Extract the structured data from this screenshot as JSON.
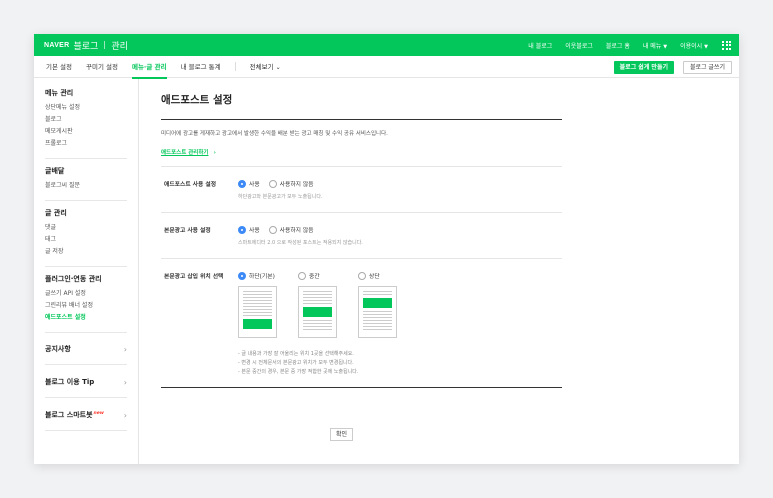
{
  "topbar": {
    "logo": "NAVER",
    "blog": "블로그",
    "manage": "관리",
    "nav": [
      "내 블로그",
      "이웃블로그",
      "블로그 홈",
      "내 메뉴",
      "이용이시"
    ]
  },
  "tabs": {
    "items": [
      "기본 설정",
      "꾸미기 설정",
      "메뉴·글 관리",
      "내 블로그 통계"
    ],
    "active_index": 2,
    "view_all": "전체보기",
    "primary_button": "블로그 쉽게 만들기",
    "secondary_button": "블로그 글쓰기"
  },
  "sidebar": {
    "sections": [
      {
        "title": "메뉴 관리",
        "items": [
          "상단메뉴 설정",
          "블로그",
          "메모게시판",
          "프롤로그"
        ]
      },
      {
        "title": "글배달",
        "items": [
          "블로그씨 질문"
        ]
      },
      {
        "title": "글 관리",
        "items": [
          "댓글",
          "태그",
          "글 저장"
        ]
      },
      {
        "title": "플러그인·연동 관리",
        "items": [
          "글쓰기 API 설정",
          "그린리뷰 배너 설정",
          "애드포스트 설정"
        ],
        "active": "애드포스트 설정"
      }
    ],
    "collapsed": [
      "공지사항",
      "블로그 이용 Tip",
      "블로그 스마트봇"
    ],
    "new_badge": "new"
  },
  "main": {
    "title": "애드포스트 설정",
    "description": "미디어에 광고를 게재하고 광고에서 발생한 수익을 배분 받는 광고 매칭 및 수익 공유 서비스입니다.",
    "link": "애드포스트 관리하기",
    "link_suffix": "›",
    "rows": [
      {
        "label": "애드포스트 사용 설정",
        "options": [
          "사용",
          "사용하지 않음"
        ],
        "selected": 0,
        "help": "하단광고와 본문광고가 모두 노출됩니다."
      },
      {
        "label": "본문광고 사용 설정",
        "options": [
          "사용",
          "사용하지 않음"
        ],
        "selected": 0,
        "help": "스마트에디터 2.0 으로 작성된 포스트는 적용되지 않습니다."
      }
    ],
    "position": {
      "label": "본문광고 삽입 위치 선택",
      "options": [
        "하단(기본)",
        "중간",
        "상단"
      ],
      "selected": 0,
      "notes": [
        "- 글 내용과 가장 잘 어울리는 위치 1곳을 선택해주세요.",
        "- 변경 시 전체문서의 본문광고 위치가 모두 변경됩니다.",
        "- 본문 중간의 경우, 본문 중 가장 적합한 곳에 노출됩니다."
      ]
    },
    "confirm": "확인"
  },
  "colors": {
    "brand": "#03c75a",
    "radio": "#3d8af7"
  }
}
